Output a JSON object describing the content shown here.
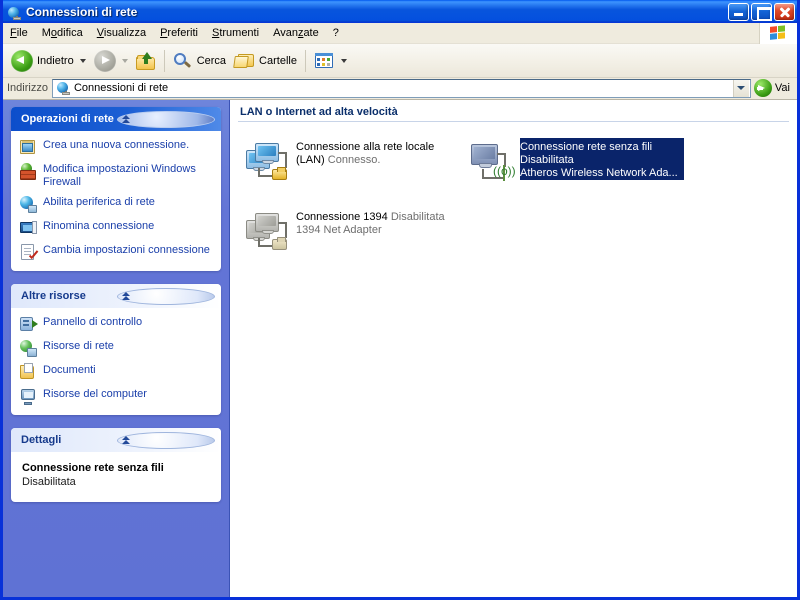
{
  "window": {
    "title": "Connessioni di rete",
    "title_icon": "network-globe-icon",
    "buttons": {
      "minimize": "minimize-button",
      "maximize": "maximize-button",
      "close": "close-button"
    }
  },
  "menubar": {
    "items": [
      {
        "label": "File",
        "accel": "F"
      },
      {
        "label": "Modifica",
        "accel": "M"
      },
      {
        "label": "Visualizza",
        "accel": "V"
      },
      {
        "label": "Preferiti",
        "accel": "P"
      },
      {
        "label": "Strumenti",
        "accel": "S"
      },
      {
        "label": "Avanzate",
        "accel": "z"
      },
      {
        "label": "?",
        "accel": ""
      }
    ],
    "brand_icon": "windows-flag-logo"
  },
  "toolbar": {
    "back_label": "Indietro",
    "back_icon": "back-arrow-icon",
    "forward_icon": "forward-arrow-icon",
    "up_icon": "up-folder-icon",
    "search_label": "Cerca",
    "search_icon": "magnifier-icon",
    "folders_label": "Cartelle",
    "folders_icon": "folders-icon",
    "views_icon": "views-tiles-icon"
  },
  "addressbar": {
    "label": "Indirizzo",
    "icon": "network-globe-icon",
    "value": "Connessioni di rete",
    "dropdown_icon": "chevron-down-icon",
    "go_label": "Vai",
    "go_icon": "go-arrow-icon"
  },
  "sidebar": {
    "panels": [
      {
        "title": "Operazioni di rete",
        "style": "dark",
        "collapse_icon": "chevron-up-icon",
        "items": [
          {
            "label": "Crea una nuova connessione.",
            "icon": "new-connection-icon"
          },
          {
            "label": "Modifica impostazioni Windows Firewall",
            "icon": "windows-firewall-icon"
          },
          {
            "label": "Abilita periferica di rete",
            "icon": "enable-network-device-icon"
          },
          {
            "label": "Rinomina connessione",
            "icon": "rename-connection-icon"
          },
          {
            "label": "Cambia impostazioni connessione",
            "icon": "connection-properties-icon"
          }
        ]
      },
      {
        "title": "Altre risorse",
        "style": "light",
        "collapse_icon": "chevron-up-icon",
        "items": [
          {
            "label": "Pannello di controllo",
            "icon": "control-panel-icon"
          },
          {
            "label": "Risorse di rete",
            "icon": "network-places-icon"
          },
          {
            "label": "Documenti",
            "icon": "my-documents-icon"
          },
          {
            "label": "Risorse del computer",
            "icon": "my-computer-icon"
          }
        ]
      }
    ],
    "details": {
      "title": "Dettagli",
      "style": "light",
      "collapse_icon": "chevron-up-icon",
      "name": "Connessione rete senza fili",
      "status": "Disabilitata"
    }
  },
  "content": {
    "group_header": "LAN o Internet ad alta velocità",
    "items": [
      {
        "name": "Connessione alla rete locale (LAN)",
        "status": "Connesso.",
        "adapter": "",
        "icon": "lan-connection-icon",
        "state": "enabled",
        "selected": false
      },
      {
        "name": "Connessione 1394",
        "status": "Disabilitata",
        "adapter": "1394 Net Adapter",
        "icon": "firewire-connection-icon",
        "state": "disabled",
        "selected": false
      },
      {
        "name": "Connessione rete senza fili",
        "status": "Disabilitata",
        "adapter": "Atheros Wireless Network Ada...",
        "icon": "wireless-connection-icon",
        "state": "disabled",
        "selected": true
      }
    ]
  },
  "colors": {
    "titlebar_blue": "#0855dd",
    "window_border": "#0831d9",
    "sidebar_blue": "#6375d6",
    "panel_head_dark": "#1c5fd4",
    "selection_blue": "#0a246a",
    "link_blue": "#1a3faa",
    "group_header_text": "#0b2f6b",
    "toolbar_bg": "#efebde"
  }
}
